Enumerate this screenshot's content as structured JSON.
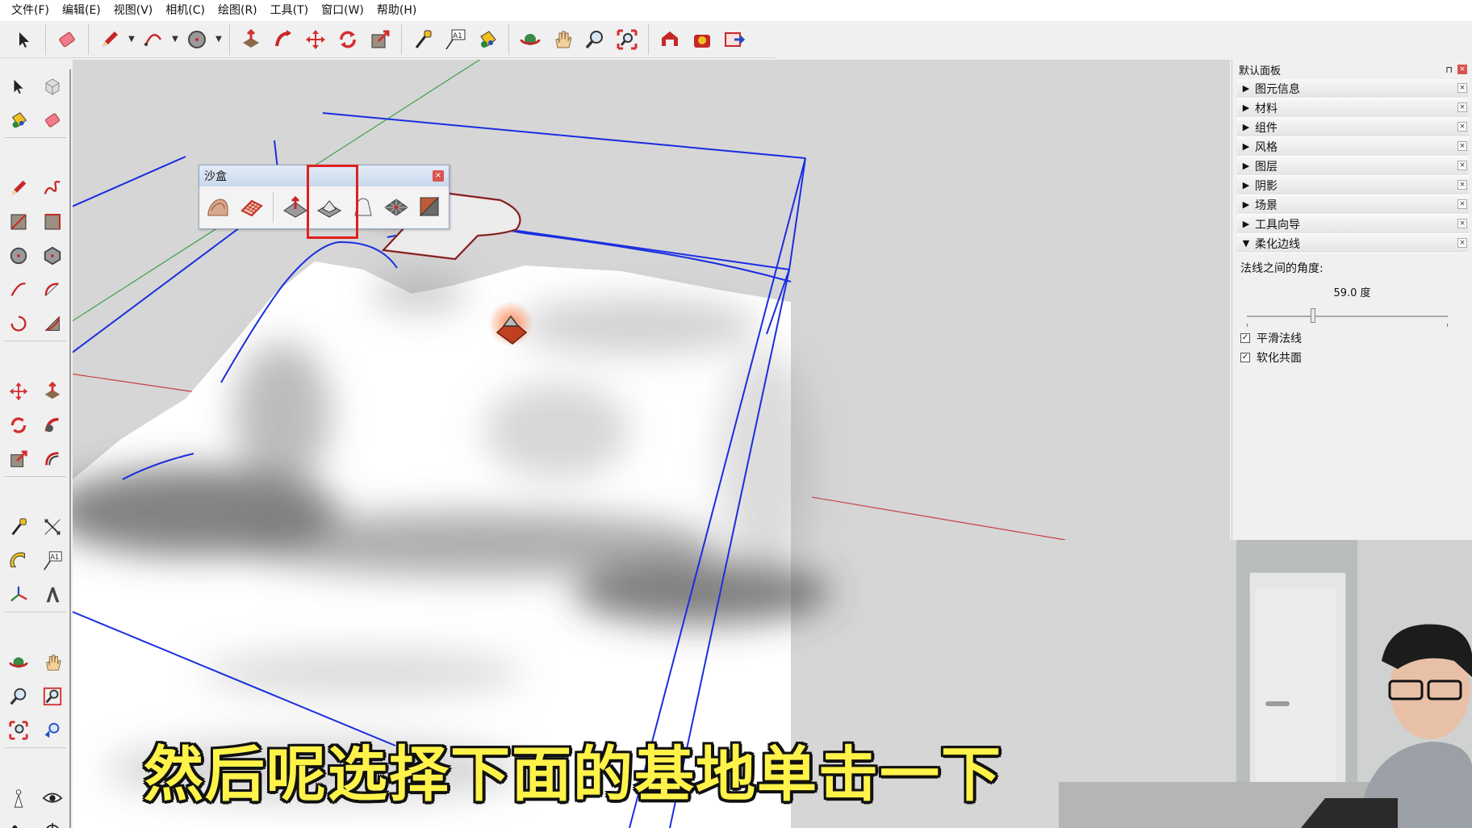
{
  "menu": {
    "items": [
      "文件(F)",
      "编辑(E)",
      "视图(V)",
      "相机(C)",
      "绘图(R)",
      "工具(T)",
      "窗口(W)",
      "帮助(H)"
    ]
  },
  "toolbar": {
    "icons": [
      "select-icon",
      "eraser-icon",
      "pencil-icon",
      "arc-icon",
      "circle-icon",
      "push-pull-icon",
      "follow-me-icon",
      "move-icon",
      "rotate-icon",
      "scale-icon",
      "tape-measure-icon",
      "text-icon",
      "paint-bucket-icon",
      "orbit-icon",
      "pan-icon",
      "zoom-icon",
      "zoom-extents-icon",
      "warehouse-icon",
      "extension-icon",
      "share-model-icon"
    ],
    "text_label": "A1"
  },
  "sandbox": {
    "title": "沙盒",
    "close": "×",
    "tools": [
      "from-contours-icon",
      "from-scratch-icon",
      "smoove-icon",
      "stamp-icon",
      "drape-icon",
      "add-detail-icon",
      "flip-edge-icon"
    ]
  },
  "panel": {
    "title": "默认面板",
    "pin": "⊓",
    "close": "×",
    "sections": [
      {
        "label": "图元信息",
        "expanded": false
      },
      {
        "label": "材料",
        "expanded": false
      },
      {
        "label": "组件",
        "expanded": false
      },
      {
        "label": "风格",
        "expanded": false
      },
      {
        "label": "图层",
        "expanded": false
      },
      {
        "label": "阴影",
        "expanded": false
      },
      {
        "label": "场景",
        "expanded": false
      },
      {
        "label": "工具向导",
        "expanded": false
      },
      {
        "label": "柔化边线",
        "expanded": true
      }
    ],
    "soften": {
      "angle_label": "法线之间的角度:",
      "angle_value": "59.0  度",
      "angle_fraction": 0.33,
      "smooth_normals": {
        "label": "平滑法线",
        "checked": true
      },
      "soften_coplanar": {
        "label": "软化共面",
        "checked": true
      }
    }
  },
  "subtitle": "然后呢选择下面的基地单击一下",
  "colors": {
    "accent_red": "#e02020",
    "edge_blue": "#1a2ee0",
    "subtitle_yellow": "#fff34a",
    "viewport_bg": "#d6d6d6"
  }
}
